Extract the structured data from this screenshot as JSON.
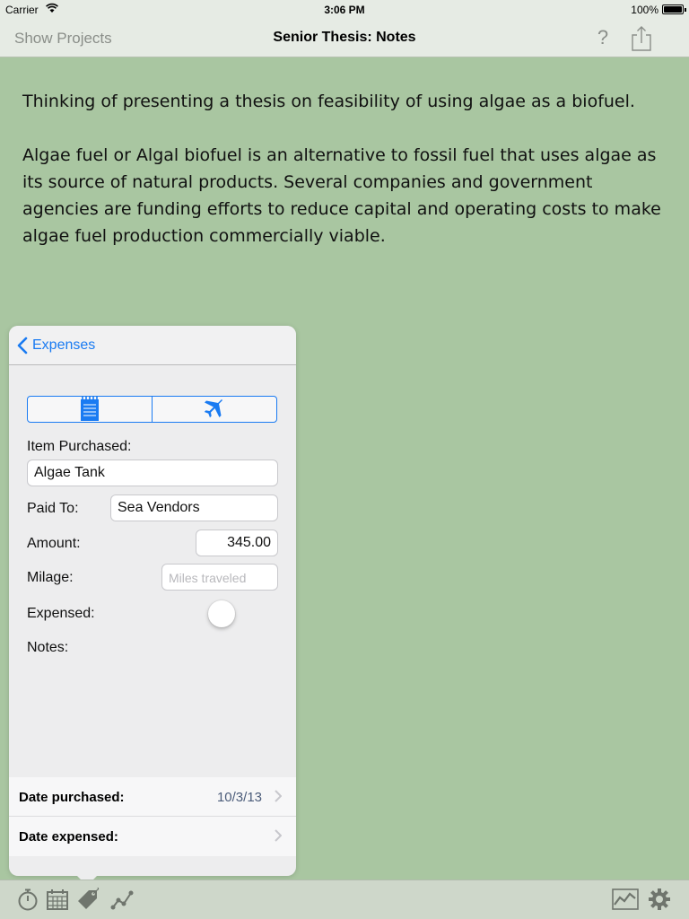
{
  "status_bar": {
    "carrier": "Carrier",
    "time": "3:06 PM",
    "battery": "100%"
  },
  "nav": {
    "back_label": "Show Projects",
    "title": "Senior Thesis: Notes",
    "help_label": "?"
  },
  "note": {
    "paragraphs": [
      "Thinking of presenting a thesis on feasibility of using algae as a biofuel.",
      "Algae fuel or Algal biofuel is an alternative to fossil fuel that uses algae as its source of natural products. Several companies and government agencies are funding efforts to reduce capital and operating costs to make algae fuel production commercially viable."
    ]
  },
  "popover": {
    "back_label": "Expenses",
    "segments": [
      "receipt-icon",
      "airplane-icon"
    ],
    "item_purchased_label": "Item Purchased:",
    "item_purchased_value": "Algae Tank",
    "paid_to_label": "Paid To:",
    "paid_to_value": "Sea Vendors",
    "amount_label": "Amount:",
    "amount_value": "345.00",
    "milage_label": "Milage:",
    "milage_placeholder": "Miles traveled",
    "expensed_label": "Expensed:",
    "expensed_on": false,
    "notes_label": "Notes:",
    "date_purchased_label": "Date purchased:",
    "date_purchased_value": "10/3/13",
    "date_expensed_label": "Date expensed:"
  },
  "tab_bar": {
    "left": [
      "stopwatch-icon",
      "calendar-icon",
      "price-tag-icon",
      "line-graph-icon"
    ],
    "right": [
      "chart-icon",
      "gear-icon"
    ]
  },
  "colors": {
    "background": "#a9c6a1",
    "accent": "#1a7bf2"
  }
}
